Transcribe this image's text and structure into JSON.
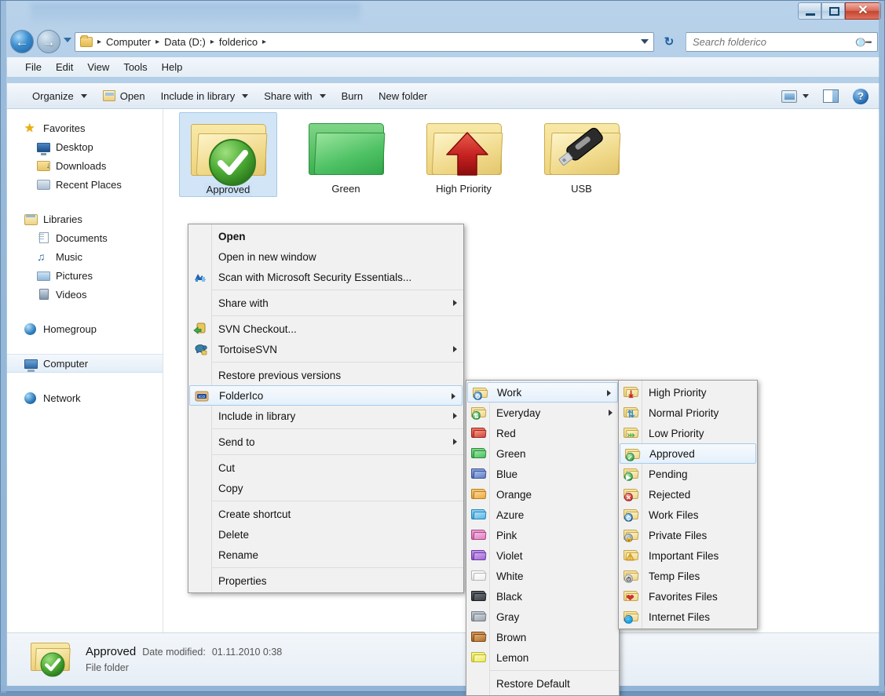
{
  "window": {
    "title_obscured": "",
    "controls": {
      "minimize": "–",
      "maximize": "□",
      "close": "✕"
    }
  },
  "address": {
    "back_glyph": "←",
    "forward_glyph": "→",
    "crumbs": [
      "Computer",
      "Data (D:)",
      "folderico"
    ],
    "separator": "▸",
    "refresh_glyph": "↻"
  },
  "search": {
    "placeholder": "Search folderico",
    "icon": "search-icon"
  },
  "menubar": {
    "items": [
      "File",
      "Edit",
      "View",
      "Tools",
      "Help"
    ]
  },
  "toolbar": {
    "organize": "Organize",
    "open": "Open",
    "include_in_library": "Include in library",
    "share_with": "Share with",
    "burn": "Burn",
    "new_folder": "New folder",
    "help_glyph": "?"
  },
  "navpane": {
    "groups": [
      {
        "header": {
          "label": "Favorites",
          "icon": "star-icon"
        },
        "items": [
          {
            "label": "Desktop",
            "icon": "desktop-icon"
          },
          {
            "label": "Downloads",
            "icon": "downloads-folder-icon"
          },
          {
            "label": "Recent Places",
            "icon": "recent-places-icon"
          }
        ]
      },
      {
        "header": {
          "label": "Libraries",
          "icon": "libraries-icon"
        },
        "items": [
          {
            "label": "Documents",
            "icon": "documents-icon"
          },
          {
            "label": "Music",
            "icon": "music-icon"
          },
          {
            "label": "Pictures",
            "icon": "pictures-icon"
          },
          {
            "label": "Videos",
            "icon": "videos-icon"
          }
        ]
      },
      {
        "header": {
          "label": "Homegroup",
          "icon": "homegroup-icon"
        },
        "items": []
      },
      {
        "header": {
          "label": "Computer",
          "icon": "computer-icon",
          "selected": true
        },
        "items": []
      },
      {
        "header": {
          "label": "Network",
          "icon": "network-icon"
        },
        "items": []
      }
    ]
  },
  "files": [
    {
      "label": "Approved",
      "icon": "folder-approved-icon",
      "selected": true
    },
    {
      "label": "Green",
      "icon": "folder-green-icon",
      "selected": false
    },
    {
      "label": "High Priority",
      "icon": "folder-high-priority-icon",
      "selected": false
    },
    {
      "label": "USB",
      "icon": "folder-usb-icon",
      "selected": false
    }
  ],
  "context_menu": {
    "items": [
      {
        "label": "Open",
        "bold": true,
        "icon": null,
        "submenu": false
      },
      {
        "label": "Open in new window",
        "bold": false,
        "icon": null,
        "submenu": false
      },
      {
        "label": "Scan with Microsoft Security Essentials...",
        "bold": false,
        "icon": "security-essentials-icon",
        "submenu": false
      },
      {
        "separator": true
      },
      {
        "label": "Share with",
        "bold": false,
        "icon": null,
        "submenu": true
      },
      {
        "separator": true
      },
      {
        "label": "SVN Checkout...",
        "bold": false,
        "icon": "svn-checkout-icon",
        "submenu": false
      },
      {
        "label": "TortoiseSVN",
        "bold": false,
        "icon": "tortoise-svn-icon",
        "submenu": true
      },
      {
        "separator": true
      },
      {
        "label": "Restore previous versions",
        "bold": false,
        "icon": null,
        "submenu": false
      },
      {
        "label": "FolderIco",
        "bold": false,
        "icon": "folderico-icon",
        "submenu": true,
        "highlighted": true
      },
      {
        "label": "Include in library",
        "bold": false,
        "icon": null,
        "submenu": true
      },
      {
        "separator": true
      },
      {
        "label": "Send to",
        "bold": false,
        "icon": null,
        "submenu": true
      },
      {
        "separator": true
      },
      {
        "label": "Cut",
        "bold": false,
        "icon": null,
        "submenu": false
      },
      {
        "label": "Copy",
        "bold": false,
        "icon": null,
        "submenu": false
      },
      {
        "separator": true
      },
      {
        "label": "Create shortcut",
        "bold": false,
        "icon": null,
        "submenu": false
      },
      {
        "label": "Delete",
        "bold": false,
        "icon": null,
        "submenu": false
      },
      {
        "label": "Rename",
        "bold": false,
        "icon": null,
        "submenu": false
      },
      {
        "separator": true
      },
      {
        "label": "Properties",
        "bold": false,
        "icon": null,
        "submenu": false
      }
    ]
  },
  "folderico_submenu": {
    "items": [
      {
        "label": "Work",
        "icon": "folder-work-icon",
        "color": "#f0d98a",
        "badge": "gear",
        "badge_color": "#2f7fc0",
        "submenu": true,
        "highlighted": true
      },
      {
        "label": "Everyday",
        "icon": "folder-everyday-icon",
        "color": "#f0d98a",
        "badge": "arrow",
        "badge_color": "#3faa4f",
        "submenu": true
      },
      {
        "label": "Red",
        "icon": "folder-red-icon",
        "color": "#e0483a",
        "submenu": false
      },
      {
        "label": "Green",
        "icon": "folder-green-icon",
        "color": "#4cc062",
        "submenu": false
      },
      {
        "label": "Blue",
        "icon": "folder-blue-icon",
        "color": "#5f7fc9",
        "submenu": false
      },
      {
        "label": "Orange",
        "icon": "folder-orange-icon",
        "color": "#f0a93c",
        "submenu": false
      },
      {
        "label": "Azure",
        "icon": "folder-azure-icon",
        "color": "#57b6e8",
        "submenu": false
      },
      {
        "label": "Pink",
        "icon": "folder-pink-icon",
        "color": "#e080c0",
        "submenu": false
      },
      {
        "label": "Violet",
        "icon": "folder-violet-icon",
        "color": "#a267d6",
        "submenu": false
      },
      {
        "label": "White",
        "icon": "folder-white-icon",
        "color": "#f2f2f2",
        "submenu": false
      },
      {
        "label": "Black",
        "icon": "folder-black-icon",
        "color": "#3a3f45",
        "submenu": false
      },
      {
        "label": "Gray",
        "icon": "folder-gray-icon",
        "color": "#9aa3ad",
        "submenu": false
      },
      {
        "label": "Brown",
        "icon": "folder-brown-icon",
        "color": "#b3702c",
        "submenu": false
      },
      {
        "label": "Lemon",
        "icon": "folder-lemon-icon",
        "color": "#ecea5a",
        "submenu": false
      },
      {
        "separator": true
      },
      {
        "label": "Restore Default",
        "icon": null,
        "submenu": false
      }
    ]
  },
  "work_submenu": {
    "items": [
      {
        "label": "High Priority",
        "icon": "folder-high-priority-icon",
        "badge_color": "#cc2222"
      },
      {
        "label": "Normal Priority",
        "icon": "folder-normal-priority-icon",
        "badge_color": "#2f8fd0"
      },
      {
        "label": "Low Priority",
        "icon": "folder-low-priority-icon",
        "badge_color": "#3faa4f"
      },
      {
        "label": "Approved",
        "icon": "folder-approved-icon",
        "badge_color": "#3faa4f",
        "highlighted": true
      },
      {
        "label": "Pending",
        "icon": "folder-pending-icon",
        "badge_color": "#3faa4f"
      },
      {
        "label": "Rejected",
        "icon": "folder-rejected-icon",
        "badge_color": "#d03030"
      },
      {
        "label": "Work Files",
        "icon": "folder-work-files-icon",
        "badge_color": "#2f7fc0"
      },
      {
        "label": "Private Files",
        "icon": "folder-private-files-icon",
        "badge_color": "#9aa3ad"
      },
      {
        "label": "Important Files",
        "icon": "folder-important-files-icon",
        "badge_color": "#e8a515"
      },
      {
        "label": "Temp Files",
        "icon": "folder-temp-files-icon",
        "badge_color": "#b8b8b8"
      },
      {
        "label": "Favorites Files",
        "icon": "folder-favorites-files-icon",
        "badge_color": "#d03030"
      },
      {
        "label": "Internet Files",
        "icon": "folder-internet-files-icon",
        "badge_color": "#2f7fc0"
      }
    ]
  },
  "details": {
    "name": "Approved",
    "meta_label": "Date modified:",
    "meta_value": "01.11.2010 0:38",
    "type": "File folder"
  }
}
